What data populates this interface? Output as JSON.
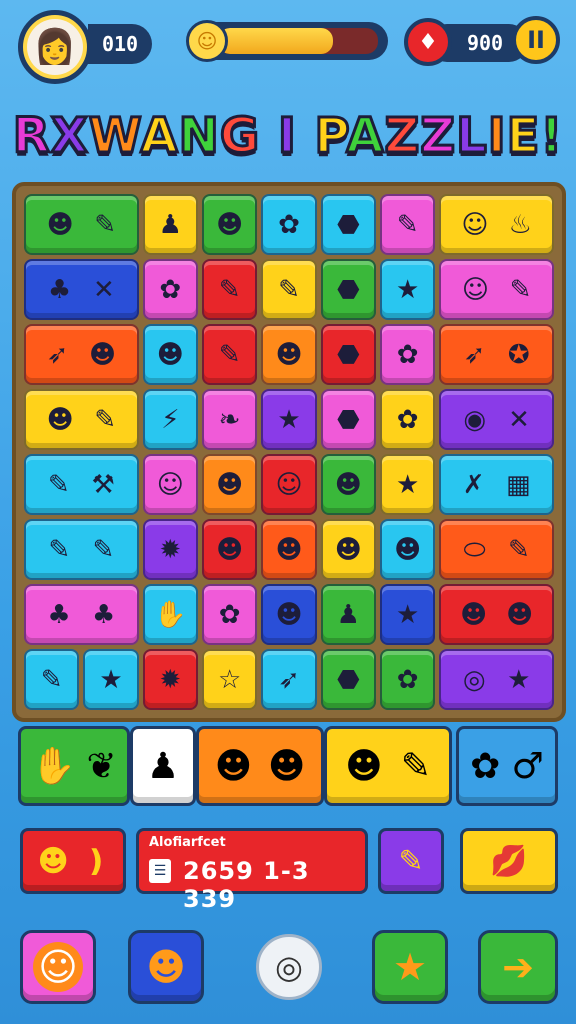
{
  "header": {
    "avatar_icon": "👩",
    "score": "010",
    "progress": 0.72,
    "progress_icon": "☺",
    "gem_icon": "♦",
    "gems": "900",
    "pause_label": "II"
  },
  "title": "RXWANG I PAZZLIE!",
  "board": {
    "rows": [
      [
        {
          "color": "#3ab83a",
          "span": 2,
          "icons": [
            "☻",
            "✎"
          ]
        },
        {
          "color": "#ffd21a",
          "span": 1,
          "icons": [
            "♟"
          ]
        },
        {
          "color": "#3ab83a",
          "span": 1,
          "icons": [
            "☻"
          ]
        },
        {
          "color": "#29c6f0",
          "span": 1,
          "icons": [
            "✿"
          ]
        },
        {
          "color": "#29c6f0",
          "span": 1,
          "icons": [
            "⬣"
          ]
        },
        {
          "color": "#f05ad8",
          "span": 1,
          "icons": [
            "✎"
          ]
        },
        {
          "color": "#ffd21a",
          "span": 2,
          "icons": [
            "☺",
            "♨"
          ]
        }
      ],
      [
        {
          "color": "#2a4fd8",
          "span": 2,
          "icons": [
            "♣",
            "✕"
          ]
        },
        {
          "color": "#f05ad8",
          "span": 1,
          "icons": [
            "✿"
          ]
        },
        {
          "color": "#e8262a",
          "span": 1,
          "icons": [
            "✎"
          ]
        },
        {
          "color": "#ffd21a",
          "span": 1,
          "icons": [
            "✎"
          ]
        },
        {
          "color": "#3ab83a",
          "span": 1,
          "icons": [
            "⬣"
          ]
        },
        {
          "color": "#29c6f0",
          "span": 1,
          "icons": [
            "★"
          ]
        },
        {
          "color": "#f05ad8",
          "span": 2,
          "icons": [
            "☺",
            "✎"
          ]
        }
      ],
      [
        {
          "color": "#ff5a1a",
          "span": 2,
          "icons": [
            "➶",
            "☻"
          ]
        },
        {
          "color": "#29c6f0",
          "span": 1,
          "icons": [
            "☻"
          ]
        },
        {
          "color": "#e8262a",
          "span": 1,
          "icons": [
            "✎"
          ]
        },
        {
          "color": "#ff8a1a",
          "span": 1,
          "icons": [
            "☻"
          ]
        },
        {
          "color": "#e8262a",
          "span": 1,
          "icons": [
            "⬣"
          ]
        },
        {
          "color": "#f05ad8",
          "span": 1,
          "icons": [
            "✿"
          ]
        },
        {
          "color": "#ff5a1a",
          "span": 2,
          "icons": [
            "➶",
            "✪"
          ]
        }
      ],
      [
        {
          "color": "#ffd21a",
          "span": 2,
          "icons": [
            "☻",
            "✎"
          ]
        },
        {
          "color": "#29c6f0",
          "span": 1,
          "icons": [
            "⚡"
          ]
        },
        {
          "color": "#f05ad8",
          "span": 1,
          "icons": [
            "❧"
          ]
        },
        {
          "color": "#8a3be8",
          "span": 1,
          "icons": [
            "★"
          ]
        },
        {
          "color": "#f05ad8",
          "span": 1,
          "icons": [
            "⬣"
          ]
        },
        {
          "color": "#ffd21a",
          "span": 1,
          "icons": [
            "✿"
          ]
        },
        {
          "color": "#8a3be8",
          "span": 2,
          "icons": [
            "◉",
            "✕"
          ]
        }
      ],
      [
        {
          "color": "#29c6f0",
          "span": 2,
          "icons": [
            "✎",
            "⚒"
          ]
        },
        {
          "color": "#f05ad8",
          "span": 1,
          "icons": [
            "☺"
          ]
        },
        {
          "color": "#ff8a1a",
          "span": 1,
          "icons": [
            "☻"
          ]
        },
        {
          "color": "#e8262a",
          "span": 1,
          "icons": [
            "☺"
          ]
        },
        {
          "color": "#3ab83a",
          "span": 1,
          "icons": [
            "☻"
          ]
        },
        {
          "color": "#ffd21a",
          "span": 1,
          "icons": [
            "★"
          ]
        },
        {
          "color": "#29c6f0",
          "span": 2,
          "icons": [
            "✗",
            "▦"
          ]
        }
      ],
      [
        {
          "color": "#29c6f0",
          "span": 2,
          "icons": [
            "✎",
            "✎"
          ]
        },
        {
          "color": "#8a3be8",
          "span": 1,
          "icons": [
            "✹"
          ]
        },
        {
          "color": "#e8262a",
          "span": 1,
          "icons": [
            "☻"
          ]
        },
        {
          "color": "#ff5a1a",
          "span": 1,
          "icons": [
            "☻"
          ]
        },
        {
          "color": "#ffd21a",
          "span": 1,
          "icons": [
            "☻"
          ]
        },
        {
          "color": "#29c6f0",
          "span": 1,
          "icons": [
            "☻"
          ]
        },
        {
          "color": "#ff5a1a",
          "span": 2,
          "icons": [
            "⬭",
            "✎"
          ]
        }
      ],
      [
        {
          "color": "#f05ad8",
          "span": 2,
          "icons": [
            "♣",
            "♣"
          ]
        },
        {
          "color": "#29c6f0",
          "span": 1,
          "icons": [
            "✋"
          ]
        },
        {
          "color": "#f05ad8",
          "span": 1,
          "icons": [
            "✿"
          ]
        },
        {
          "color": "#2a4fd8",
          "span": 1,
          "icons": [
            "☻"
          ]
        },
        {
          "color": "#3ab83a",
          "span": 1,
          "icons": [
            "♟"
          ]
        },
        {
          "color": "#2a4fd8",
          "span": 1,
          "icons": [
            "★"
          ]
        },
        {
          "color": "#e8262a",
          "span": 2,
          "icons": [
            "☻",
            "☻"
          ]
        }
      ],
      [
        {
          "color": "#29c6f0",
          "span": 1,
          "icons": [
            "✎"
          ]
        },
        {
          "color": "#29c6f0",
          "span": 1,
          "icons": [
            "★"
          ]
        },
        {
          "color": "#e8262a",
          "span": 1,
          "icons": [
            "✹"
          ]
        },
        {
          "color": "#ffd21a",
          "span": 1,
          "icons": [
            "☆"
          ]
        },
        {
          "color": "#29c6f0",
          "span": 1,
          "icons": [
            "➶"
          ]
        },
        {
          "color": "#3ab83a",
          "span": 1,
          "icons": [
            "⬣"
          ]
        },
        {
          "color": "#3ab83a",
          "span": 1,
          "icons": [
            "✿"
          ]
        },
        {
          "color": "#8a3be8",
          "span": 2,
          "icons": [
            "◎",
            "★"
          ]
        }
      ]
    ]
  },
  "tray": [
    {
      "color": "#3ab83a",
      "icons": [
        "✋",
        "❦"
      ]
    },
    {
      "color": "#ffffff",
      "icons": [
        "♟"
      ]
    },
    {
      "color": "#ff8a1a",
      "icons": [
        "☻",
        "☻"
      ]
    },
    {
      "color": "#ffd21a",
      "icons": [
        "☻",
        "✎"
      ]
    },
    {
      "color": "#3aa0e6",
      "icons": [
        "✿",
        "♂"
      ]
    }
  ],
  "info_row": {
    "left_button_icons": [
      "☻",
      "❫"
    ],
    "stats_label": "Alofiarfcet",
    "stats_icon": "☰",
    "stats_values": "2659  1-3  339",
    "pencil_button_icon": "✎",
    "lips_button_icon": "💋"
  },
  "nav": {
    "nav1_icon": "☺",
    "nav2_icon": "☻",
    "center_icon": "◎",
    "star_icon": "★",
    "arrow_icon": "➔"
  }
}
